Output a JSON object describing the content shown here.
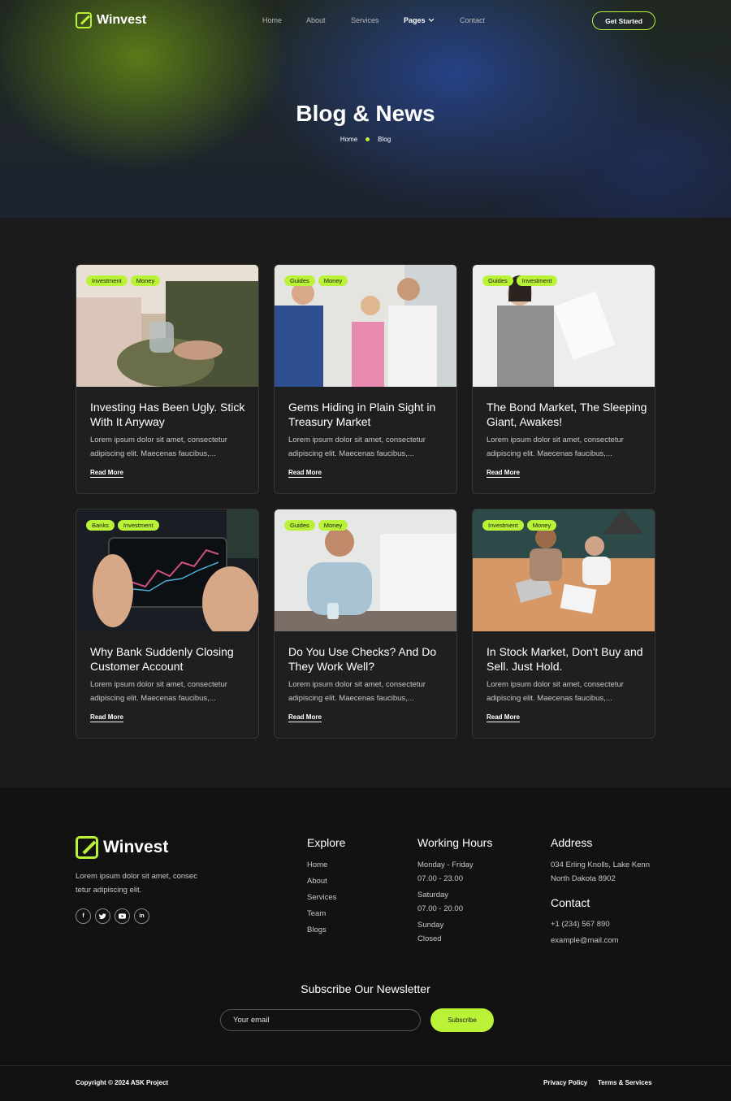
{
  "brand": {
    "name": "Winvest",
    "accent": "#b9f236"
  },
  "nav": {
    "items": [
      "Home",
      "About",
      "Services",
      "Pages",
      "Contact"
    ],
    "cta": "Get Started"
  },
  "hero": {
    "title": "Blog & News",
    "breadcrumb": [
      "Home",
      "Blog"
    ]
  },
  "posts": [
    {
      "tags": [
        "Investment",
        "Money"
      ],
      "title": "Investing Has Been Ugly. Stick With It Anyway",
      "excerpt": "Lorem ipsum dolor sit amet, consectetur adipiscing elit. Maecenas faucibus,...",
      "link": "Read More"
    },
    {
      "tags": [
        "Guides",
        "Money"
      ],
      "title": "Gems Hiding in Plain Sight in Treasury Market",
      "excerpt": "Lorem ipsum dolor sit amet, consectetur adipiscing elit. Maecenas faucibus,...",
      "link": "Read More"
    },
    {
      "tags": [
        "Guides",
        "Investment"
      ],
      "title": "The Bond Market, The Sleeping Giant, Awakes!",
      "excerpt": "Lorem ipsum dolor sit amet, consectetur adipiscing elit. Maecenas faucibus,...",
      "link": "Read More"
    },
    {
      "tags": [
        "Banks",
        "Investment"
      ],
      "title": "Why Bank Suddenly Closing Customer Account",
      "excerpt": "Lorem ipsum dolor sit amet, consectetur adipiscing elit. Maecenas faucibus,...",
      "link": "Read More"
    },
    {
      "tags": [
        "Guides",
        "Money"
      ],
      "title": "Do You Use Checks? And Do They Work Well?",
      "excerpt": "Lorem ipsum dolor sit amet, consectetur adipiscing elit. Maecenas faucibus,...",
      "link": "Read More"
    },
    {
      "tags": [
        "Investment",
        "Money"
      ],
      "title": "In Stock Market, Don't Buy and Sell. Just Hold.",
      "excerpt": "Lorem ipsum dolor sit amet, consectetur adipiscing elit. Maecenas faucibus,...",
      "link": "Read More"
    }
  ],
  "footer": {
    "about": "Lorem ipsum dolor sit amet, consec tetur adipiscing elit.",
    "socials": [
      "f",
      "t",
      "yt",
      "in"
    ],
    "explore": {
      "title": "Explore",
      "items": [
        "Home",
        "About",
        "Services",
        "Team",
        "Blogs"
      ]
    },
    "hours": {
      "title": "Working Hours",
      "items": [
        "Monday - Friday",
        "07.00 - 23.00",
        "Saturday",
        "07.00 - 20.00",
        "Sunday",
        "Closed"
      ]
    },
    "address": {
      "title": "Address",
      "lines": [
        "034 Erling Knolls, Lake Kenn",
        "North Dakota 8902"
      ]
    },
    "contact": {
      "title": "Contact",
      "phone": "+1 (234) 567 890",
      "email": "example@mail.com"
    },
    "newsletter": {
      "title": "Subscribe Our Newsletter",
      "placeholder": "Your email",
      "button": "Subscribe"
    },
    "copyright": "Copyright © 2024 ASK Project",
    "legal": [
      "Privacy Policy",
      "Terms & Services"
    ]
  }
}
